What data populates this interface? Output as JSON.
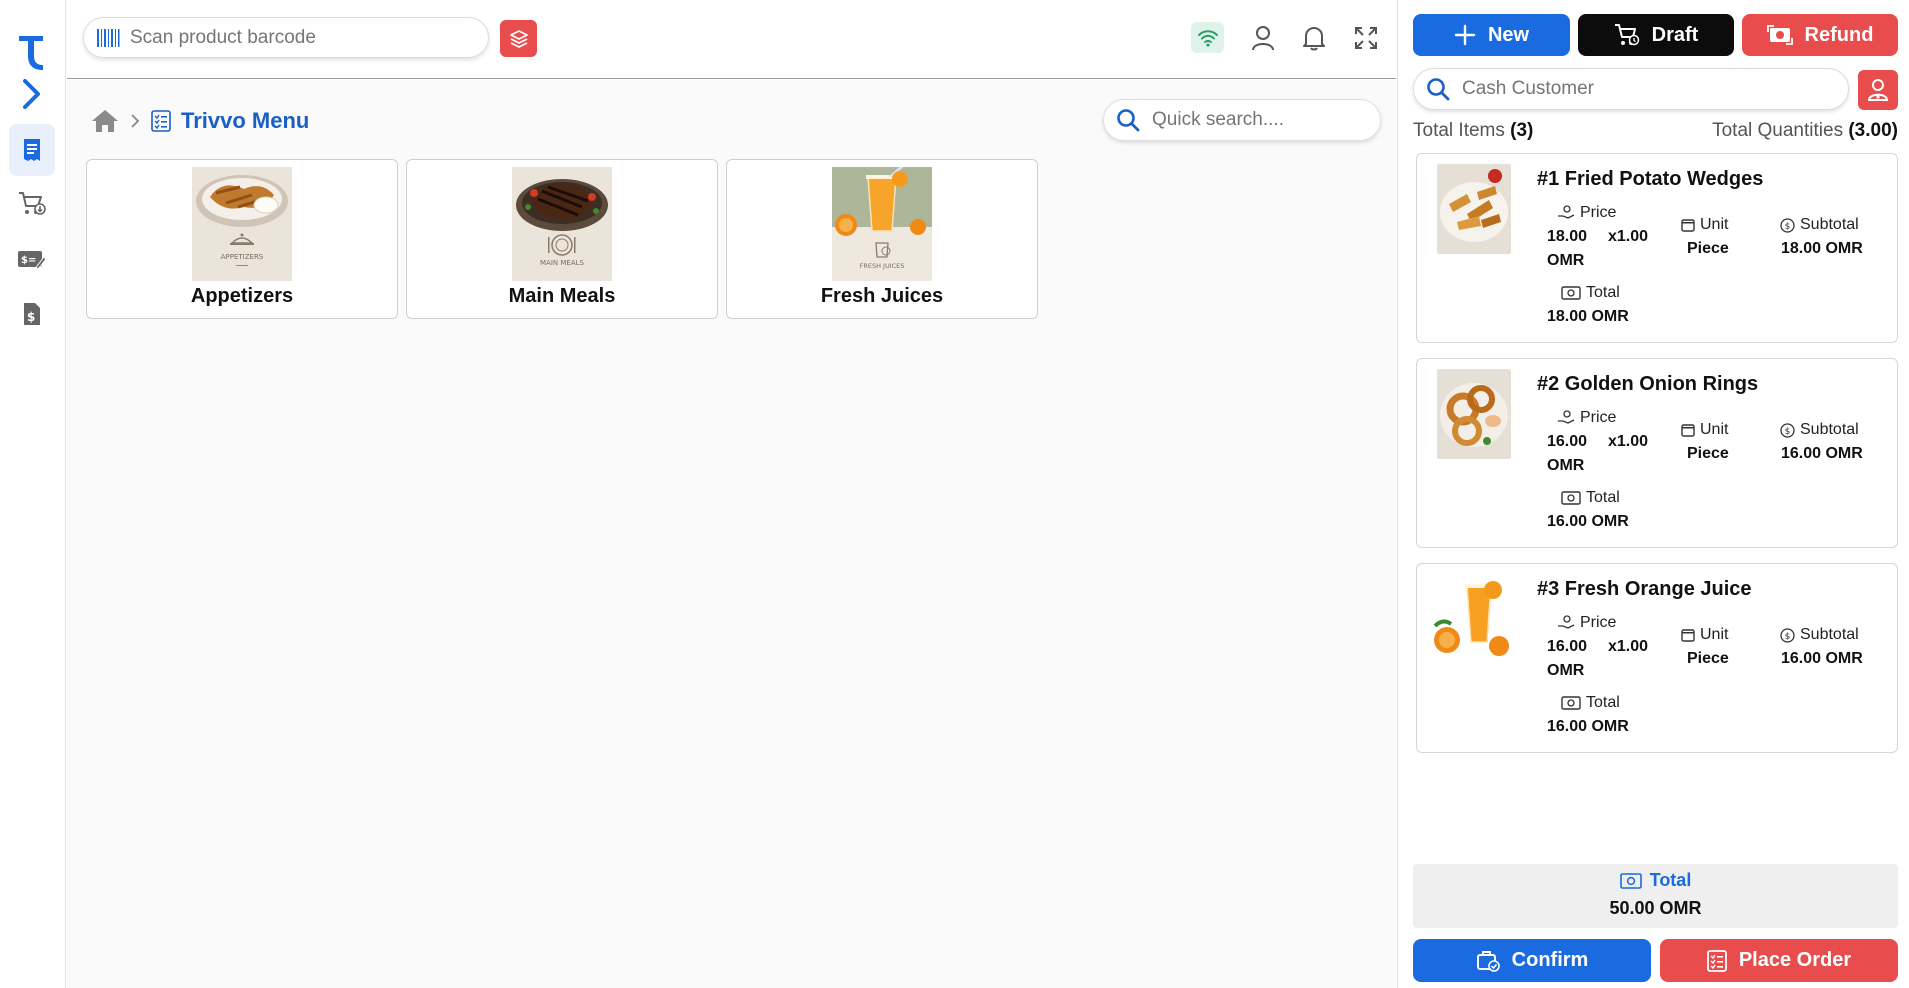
{
  "topbar": {
    "barcode_placeholder": "Scan product barcode"
  },
  "breadcrumb": {
    "current": "Trivvo Menu"
  },
  "search": {
    "placeholder": "Quick search...."
  },
  "categories": [
    {
      "name": "Appetizers",
      "image_caption": "APPETIZERS",
      "icon": "cloche-icon"
    },
    {
      "name": "Main Meals",
      "image_caption": "MAIN MEALS",
      "icon": "plate-cutlery-icon"
    },
    {
      "name": "Fresh Juices",
      "image_caption": "FRESH JUICES",
      "icon": "juice-icon"
    }
  ],
  "actions": {
    "new": "New",
    "draft": "Draft",
    "refund": "Refund"
  },
  "customer": {
    "placeholder": "Cash Customer"
  },
  "summary": {
    "total_items_label": "Total Items",
    "total_items_value": "(3)",
    "total_quantities_label": "Total Quantities",
    "total_quantities_value": "(3.00)"
  },
  "cart_labels": {
    "price": "Price",
    "unit": "Unit",
    "subtotal": "Subtotal",
    "total": "Total"
  },
  "cart": [
    {
      "name": "#1 Fried Potato Wedges",
      "price": "18.00",
      "qty": "x1.00",
      "currency": "OMR",
      "unit": "Piece",
      "subtotal": "18.00 OMR",
      "total": "18.00 OMR"
    },
    {
      "name": "#2 Golden Onion Rings",
      "price": "16.00",
      "qty": "x1.00",
      "currency": "OMR",
      "unit": "Piece",
      "subtotal": "16.00 OMR",
      "total": "16.00 OMR"
    },
    {
      "name": "#3 Fresh Orange Juice",
      "price": "16.00",
      "qty": "x1.00",
      "currency": "OMR",
      "unit": "Piece",
      "subtotal": "16.00 OMR",
      "total": "16.00 OMR"
    }
  ],
  "grand_total": {
    "label": "Total",
    "value": "50.00 OMR"
  },
  "footer": {
    "confirm": "Confirm",
    "place_order": "Place Order"
  },
  "colors": {
    "primary": "#1a6ae0",
    "danger": "#e84c4c",
    "dark": "#0c0c0c",
    "wifi_bg": "#dff3ea"
  }
}
